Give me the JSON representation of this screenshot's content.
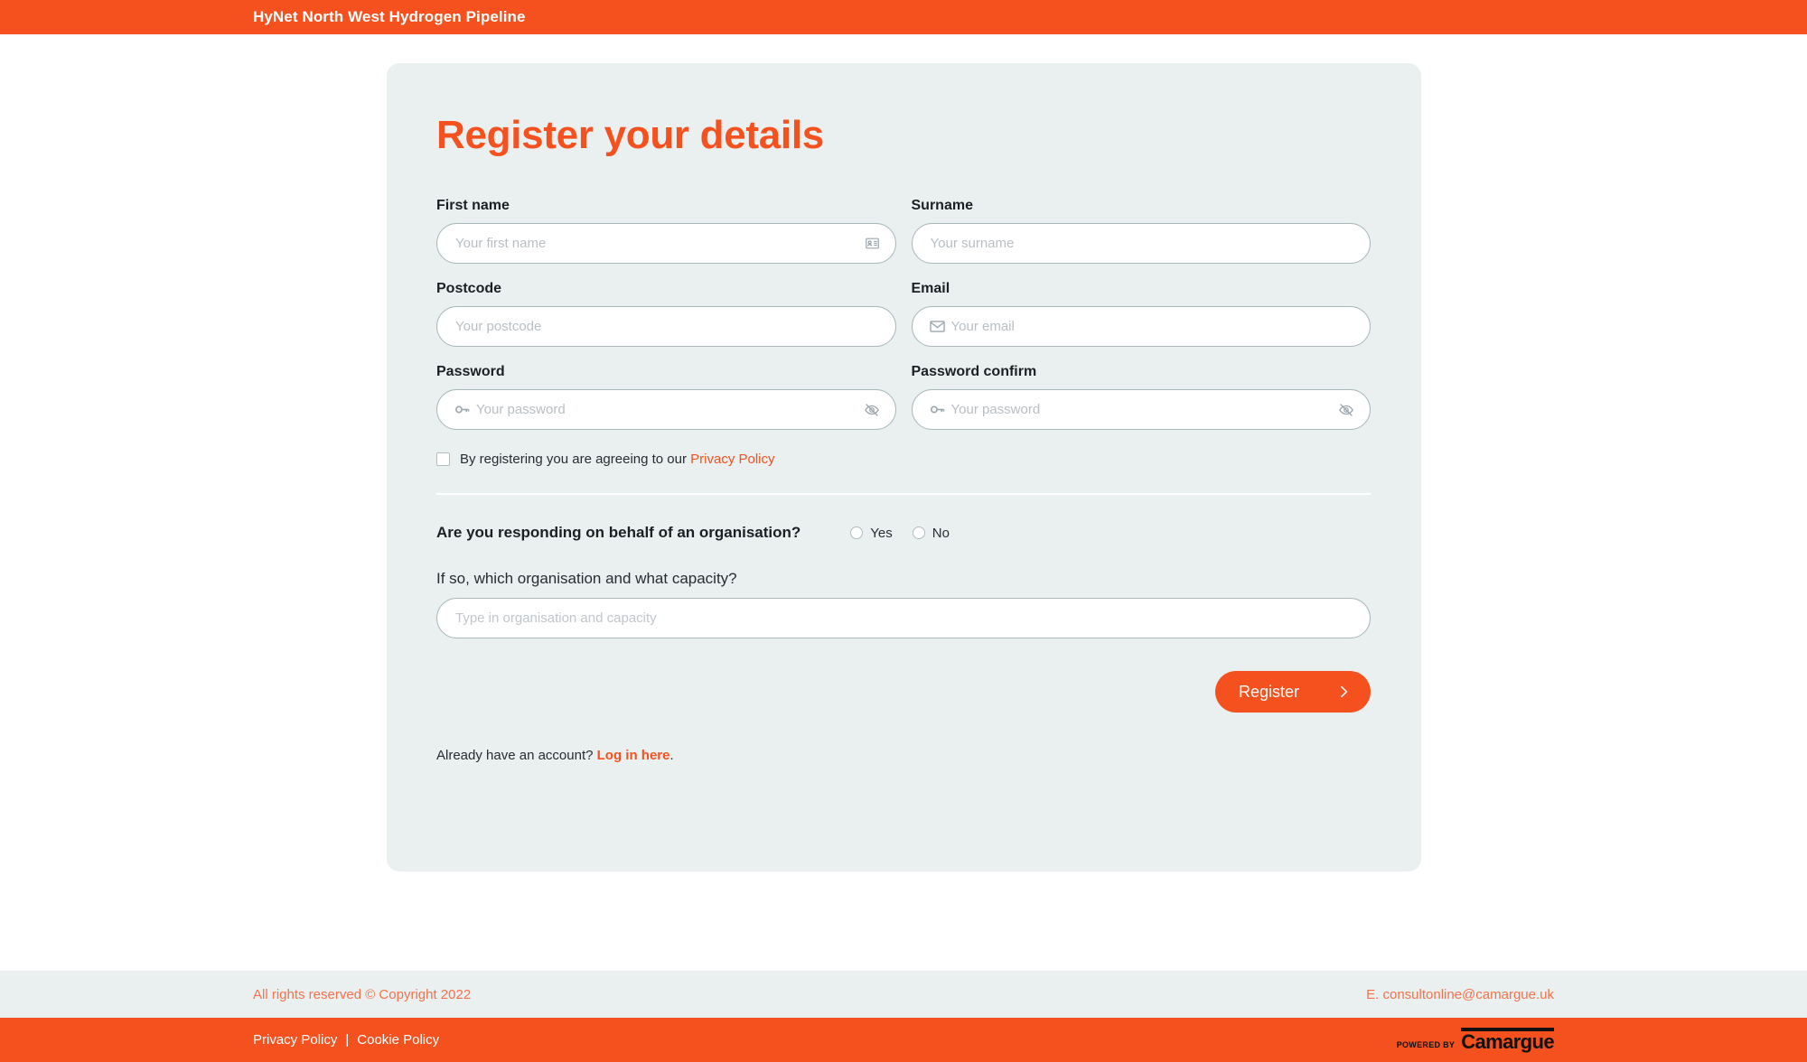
{
  "topbar": {
    "title": "HyNet North West Hydrogen Pipeline"
  },
  "card": {
    "title": "Register your details",
    "fields": {
      "first_name": {
        "label": "First name",
        "placeholder": "Your first name",
        "value": "",
        "right_icon": "contact-card-icon"
      },
      "surname": {
        "label": "Surname",
        "placeholder": "Your surname",
        "value": ""
      },
      "postcode": {
        "label": "Postcode",
        "placeholder": "Your postcode",
        "value": ""
      },
      "email": {
        "label": "Email",
        "placeholder": "Your email",
        "value": "",
        "left_icon": "envelope-icon"
      },
      "password": {
        "label": "Password",
        "placeholder": "Your password",
        "value": "",
        "left_icon": "key-icon",
        "right_icon": "eye-off-icon"
      },
      "password_confirm": {
        "label": "Password confirm",
        "placeholder": "Your password",
        "value": "",
        "left_icon": "key-icon",
        "right_icon": "eye-off-icon"
      }
    },
    "consent": {
      "text": "By registering you are agreeing to our ",
      "link_label": "Privacy Policy",
      "checked": false
    },
    "organisation": {
      "question": "Are you responding on behalf of an organisation?",
      "options": [
        "Yes",
        "No"
      ],
      "selected": "",
      "sub_label": "If so, which organisation and what capacity?",
      "placeholder": "Type in organisation and capacity",
      "value": ""
    },
    "submit": {
      "label": "Register",
      "arrow": "chevron-right-icon"
    },
    "login": {
      "prefix": "Already have an account? ",
      "link_label": "Log in here",
      "suffix": "."
    }
  },
  "footer": {
    "copyright": "All rights reserved © Copyright 2022",
    "email": "E. consultonline@camargue.uk",
    "privacy_label": "Privacy Policy",
    "separator": "|",
    "cookie_label": "Cookie Policy",
    "brand_powered": "POWERED BY",
    "brand_name": "Camargue"
  },
  "colors": {
    "accent": "#f4511e",
    "card_bg": "#eaeff0",
    "input_border": "#a9b8ba",
    "text": "#272d32"
  }
}
